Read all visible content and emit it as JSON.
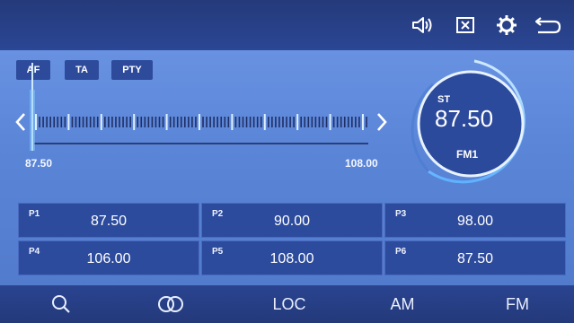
{
  "topbar": {
    "icons": {
      "volume": "volume-icon",
      "mute": "mute-icon",
      "settings": "gear-icon",
      "back": "back-icon"
    }
  },
  "rds": {
    "buttons": [
      {
        "label": "AF"
      },
      {
        "label": "TA"
      },
      {
        "label": "PTY"
      }
    ]
  },
  "tuner": {
    "min_label": "87.50",
    "max_label": "108.00",
    "current_fraction": 0.0
  },
  "dial": {
    "st": "ST",
    "frequency": "87.50",
    "band": "FM1"
  },
  "presets": [
    {
      "label": "P1",
      "freq": "87.50"
    },
    {
      "label": "P2",
      "freq": "90.00"
    },
    {
      "label": "P3",
      "freq": "98.00"
    },
    {
      "label": "P4",
      "freq": "106.00"
    },
    {
      "label": "P5",
      "freq": "108.00"
    },
    {
      "label": "P6",
      "freq": "87.50"
    }
  ],
  "bottombar": {
    "search_icon": "search-icon",
    "stereo_icon": "stereo-icon",
    "loc": "LOC",
    "am": "AM",
    "fm": "FM"
  },
  "colors": {
    "background": "#5b86d8",
    "bar": "#243a7a",
    "accent": "#2d4b9d",
    "glow": "#8fd0ff"
  }
}
